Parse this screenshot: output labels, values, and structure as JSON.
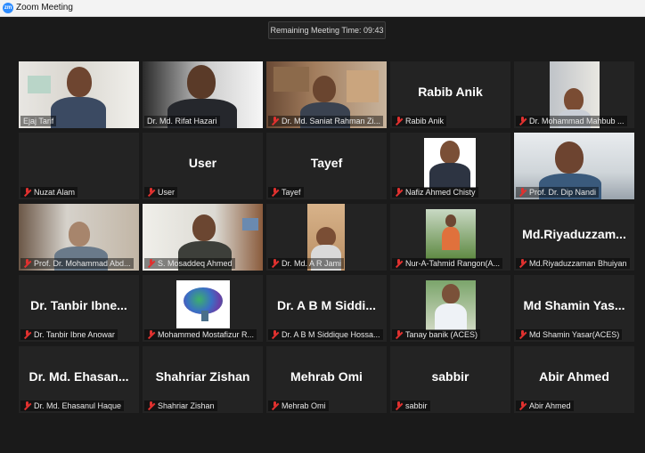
{
  "window": {
    "title": "Zoom Meeting",
    "logo_text": "zm"
  },
  "meeting": {
    "remaining_time": "Remaining Meeting Time: 09:43"
  },
  "participants": [
    {
      "name": "Ejaj Tarif",
      "display": "",
      "video": true
    },
    {
      "name": "Dr. Md. Rifat Hazari",
      "display": "",
      "video": true,
      "active_speaker": true
    },
    {
      "name": "Dr. Md. Saniat Rahman Zi...",
      "display": "",
      "video": true
    },
    {
      "name": "Rabib Anik",
      "display": "Rabib Anik",
      "video": false
    },
    {
      "name": "Dr. Mohammad Mahbub ...",
      "display": "",
      "video": true
    },
    {
      "name": "Nuzat Alam",
      "display": "",
      "video": false
    },
    {
      "name": "User",
      "display": "User",
      "video": false
    },
    {
      "name": "Tayef",
      "display": "Tayef",
      "video": false
    },
    {
      "name": "Nafiz Ahmed Chisty",
      "display": "",
      "video": true
    },
    {
      "name": "Prof. Dr. Dip Nandi",
      "display": "",
      "video": true
    },
    {
      "name": "Prof. Dr. Mohammad Abd...",
      "display": "",
      "video": true
    },
    {
      "name": "S. Mosaddeq Ahmed",
      "display": "",
      "video": true
    },
    {
      "name": "Dr. Md. A R Jami",
      "display": "",
      "video": true
    },
    {
      "name": "Nur-A-Tahmid Rangon(A...",
      "display": "",
      "video": true
    },
    {
      "name": "Md.Riyaduzzaman Bhuiyan",
      "display": "Md.Riyaduzzam...",
      "video": false
    },
    {
      "name": "Dr. Tanbir Ibne Anowar",
      "display": "Dr. Tanbir Ibne...",
      "video": false
    },
    {
      "name": "Mohammed Mostafizur R...",
      "display": "",
      "video": true
    },
    {
      "name": "Dr. A B M Siddique Hossa...",
      "display": "Dr. A B M Siddi...",
      "video": false
    },
    {
      "name": "Tanay banik (ACES)",
      "display": "",
      "video": true
    },
    {
      "name": "Md Shamin Yasar(ACES)",
      "display": "Md Shamin Yas...",
      "video": false
    },
    {
      "name": "Dr. Md. Ehasanul Haque",
      "display": "Dr. Md. Ehasan...",
      "video": false
    },
    {
      "name": "Shahriar Zishan",
      "display": "Shahriar Zishan",
      "video": false
    },
    {
      "name": "Mehrab Omi",
      "display": "Mehrab Omi",
      "video": false
    },
    {
      "name": "sabbir",
      "display": "sabbir",
      "video": false
    },
    {
      "name": "Abir Ahmed",
      "display": "Abir Ahmed",
      "video": false
    }
  ],
  "colors": {
    "accent_active": "#a8d64a",
    "muted_icon": "#e0312f",
    "background": "#1a1a1a",
    "tile": "#232323"
  }
}
